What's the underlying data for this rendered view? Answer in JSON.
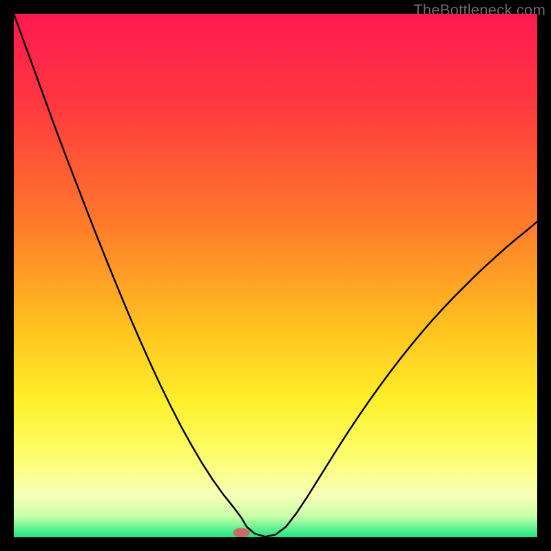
{
  "watermark": "TheBottleneck.com",
  "chart_data": {
    "type": "line",
    "title": "",
    "xlabel": "",
    "ylabel": "",
    "xlim": [
      0,
      100
    ],
    "ylim": [
      0,
      100
    ],
    "x": [
      0,
      2,
      4,
      6,
      8,
      10,
      12,
      14,
      16,
      18,
      20,
      22,
      24,
      26,
      28,
      30,
      32,
      34,
      36,
      38,
      40,
      42,
      43.5,
      44.5,
      46,
      48,
      50,
      52,
      54,
      56,
      58,
      60,
      62,
      64,
      66,
      68,
      70,
      72,
      74,
      76,
      78,
      80,
      82,
      84,
      86,
      88,
      90,
      92,
      94,
      96,
      98,
      100
    ],
    "y": [
      100,
      94.5,
      89,
      83.5,
      78,
      72.7,
      67.5,
      62.3,
      57.2,
      52.2,
      47.3,
      42.5,
      37.9,
      33.4,
      29.1,
      25.0,
      21.1,
      17.5,
      14.1,
      11.0,
      8.2,
      5.7,
      3.7,
      2.0,
      0.7,
      0.1,
      0.5,
      2.0,
      4.6,
      7.6,
      10.8,
      14.0,
      17.2,
      20.3,
      23.3,
      26.2,
      29.0,
      31.7,
      34.3,
      36.8,
      39.2,
      41.5,
      43.7,
      45.8,
      47.8,
      49.8,
      51.7,
      53.5,
      55.3,
      57.0,
      58.6,
      60.3
    ],
    "marker": {
      "x": 43.5,
      "y": 0.9,
      "color": "#c76a6a",
      "rx": 1.6,
      "ry": 0.9
    },
    "gradient_stops": [
      {
        "offset": 0,
        "color": "#ff1850"
      },
      {
        "offset": 18,
        "color": "#ff3a3f"
      },
      {
        "offset": 40,
        "color": "#ff7a2a"
      },
      {
        "offset": 60,
        "color": "#ffc21f"
      },
      {
        "offset": 74,
        "color": "#fff02a"
      },
      {
        "offset": 85,
        "color": "#fdff70"
      },
      {
        "offset": 92,
        "color": "#f8ffb8"
      },
      {
        "offset": 96,
        "color": "#c8ffa8"
      },
      {
        "offset": 100,
        "color": "#18e884"
      }
    ],
    "line_color": "#000000",
    "line_width": 2.5
  }
}
